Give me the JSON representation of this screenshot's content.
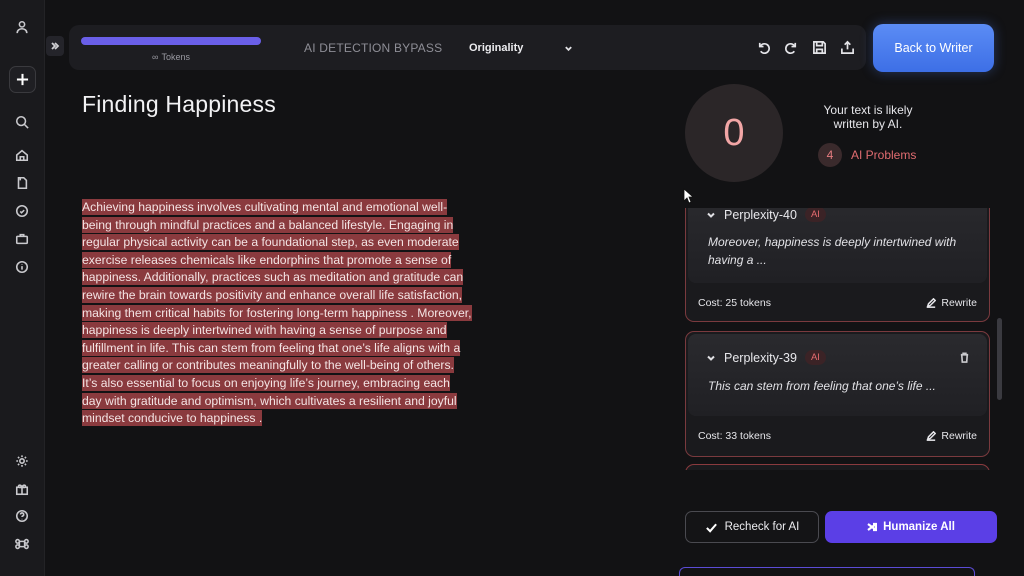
{
  "toolbar": {
    "tokens_label": "Tokens",
    "tokens_infinite": "∞",
    "mode_label": "AI DETECTION BYPASS",
    "detector_selected": "Originality",
    "back_button": "Back to Writer"
  },
  "document": {
    "title": "Finding Happiness",
    "body": "Achieving happiness involves cultivating mental and emotional well-being through mindful practices and a balanced lifestyle. Engaging in regular physical activity can be a foundational step, as even moderate exercise releases chemicals like endorphins that promote a sense of happiness. Additionally, practices such as meditation and gratitude can rewire the brain towards positivity and enhance overall life satisfaction, making them critical habits for fostering long-term happiness . Moreover, happiness is deeply intertwined with having a sense of purpose and fulfillment in life. This can stem from feeling that one’s life aligns with a greater calling or contributes meaningfully to the well-being of others. It’s also essential to focus on enjoying life’s journey, embracing each day with gratitude and optimism, which cultivates a resilient and joyful mindset conducive to happiness ."
  },
  "analysis": {
    "score": "0",
    "verdict": "Your text is likely written by AI.",
    "problem_count": "4",
    "problem_label": "AI Problems"
  },
  "issues": [
    {
      "name": "Perplexity-40",
      "tag": "AI",
      "quote": "Moreover, happiness is deeply intertwined with having a ...",
      "cost": "Cost: 25 tokens",
      "action": "Rewrite"
    },
    {
      "name": "Perplexity-39",
      "tag": "AI",
      "quote": "This can stem from feeling that one’s life ...",
      "cost": "Cost: 33 tokens",
      "action": "Rewrite"
    }
  ],
  "actions": {
    "recheck": "Recheck for AI",
    "humanize": "Humanize All"
  },
  "colors": {
    "accent": "#5b3fe6",
    "back_button": "#4a7df0",
    "highlight": "#8a3a3e",
    "problem": "#e06c70"
  }
}
